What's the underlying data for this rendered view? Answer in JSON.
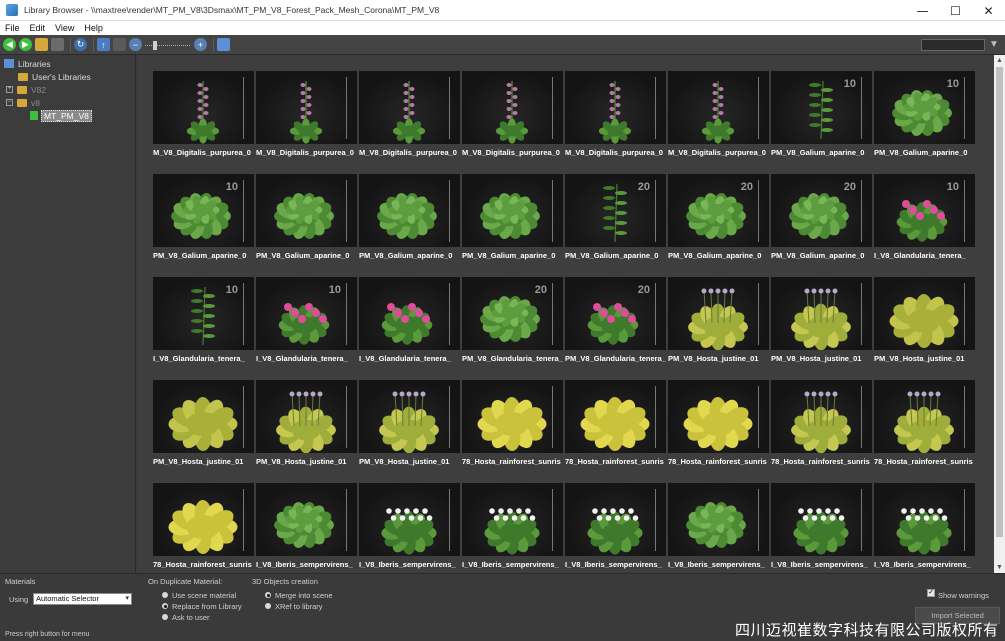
{
  "window": {
    "title": "Library Browser - \\\\maxtree\\render\\MT_PM_V8\\3Dsmax\\MT_PM_V8_Forest_Pack_Mesh_Corona\\MT_PM_V8",
    "minimize": "—",
    "maximize": "☐",
    "close": "✕"
  },
  "menu": {
    "items": [
      {
        "label": "File"
      },
      {
        "label": "Edit"
      },
      {
        "label": "View"
      },
      {
        "label": "Help"
      }
    ]
  },
  "toolbar": {
    "icons": [
      "back-icon",
      "forward-icon",
      "open-folder-icon",
      "save-icon",
      "refresh-icon",
      "sort-icon",
      "group-icon",
      "zoom-out-icon",
      "zoom-in-icon",
      "settings-icon"
    ],
    "colors": {
      "back": "#3fbf3f",
      "forward": "#3fbf3f",
      "folder": "#d4a93a"
    }
  },
  "tree": {
    "root_label": "Libraries",
    "items": [
      {
        "label": "User's Libraries"
      },
      {
        "label": "V82"
      },
      {
        "label": "v8"
      },
      {
        "label": "MT_PM_V8"
      }
    ]
  },
  "grid": {
    "tiles": [
      {
        "label": "M_V8_Digitalis_purpurea_0",
        "plant": "foxglove",
        "ruler": ""
      },
      {
        "label": "M_V8_Digitalis_purpurea_0",
        "plant": "foxglove",
        "ruler": ""
      },
      {
        "label": "M_V8_Digitalis_purpurea_0",
        "plant": "foxglove",
        "ruler": ""
      },
      {
        "label": "M_V8_Digitalis_purpurea_0",
        "plant": "foxglove",
        "ruler": ""
      },
      {
        "label": "M_V8_Digitalis_purpurea_0",
        "plant": "foxglove",
        "ruler": ""
      },
      {
        "label": "M_V8_Digitalis_purpurea_0",
        "plant": "foxglove",
        "ruler": ""
      },
      {
        "label": "PM_V8_Galium_aparine_0",
        "plant": "tall-green",
        "ruler": "10"
      },
      {
        "label": "PM_V8_Galium_aparine_0",
        "plant": "bush",
        "ruler": "10"
      },
      {
        "label": "PM_V8_Galium_aparine_0",
        "plant": "bush",
        "ruler": "10"
      },
      {
        "label": "PM_V8_Galium_aparine_0",
        "plant": "bush",
        "ruler": ""
      },
      {
        "label": "PM_V8_Galium_aparine_0",
        "plant": "bush",
        "ruler": ""
      },
      {
        "label": "PM_V8_Galium_aparine_0",
        "plant": "bush",
        "ruler": ""
      },
      {
        "label": "PM_V8_Galium_aparine_0",
        "plant": "tall-green",
        "ruler": "20"
      },
      {
        "label": "PM_V8_Galium_aparine_0",
        "plant": "bush",
        "ruler": "20"
      },
      {
        "label": "PM_V8_Galium_aparine_0",
        "plant": "bush",
        "ruler": "20"
      },
      {
        "label": "I_V8_Glandularia_tenera_",
        "plant": "pink-flower",
        "ruler": "10"
      },
      {
        "label": "I_V8_Glandularia_tenera_",
        "plant": "tall-green",
        "ruler": "10"
      },
      {
        "label": "I_V8_Glandularia_tenera_",
        "plant": "pink-flower",
        "ruler": "10"
      },
      {
        "label": "I_V8_Glandularia_tenera_",
        "plant": "pink-flower",
        "ruler": ""
      },
      {
        "label": "PM_V8_Glandularia_tenera_",
        "plant": "bush",
        "ruler": "20"
      },
      {
        "label": "PM_V8_Glandularia_tenera_",
        "plant": "pink-flower",
        "ruler": "20"
      },
      {
        "label": "PM_V8_Hosta_justine_01",
        "plant": "hosta-flower",
        "ruler": ""
      },
      {
        "label": "PM_V8_Hosta_justine_01",
        "plant": "hosta-flower",
        "ruler": ""
      },
      {
        "label": "PM_V8_Hosta_justine_01",
        "plant": "hosta",
        "ruler": ""
      },
      {
        "label": "PM_V8_Hosta_justine_01",
        "plant": "hosta",
        "ruler": ""
      },
      {
        "label": "PM_V8_Hosta_justine_01",
        "plant": "hosta-flower",
        "ruler": ""
      },
      {
        "label": "PM_V8_Hosta_justine_01",
        "plant": "hosta-flower",
        "ruler": ""
      },
      {
        "label": "78_Hosta_rainforest_sunris",
        "plant": "hosta-yellow",
        "ruler": ""
      },
      {
        "label": "78_Hosta_rainforest_sunris",
        "plant": "hosta-yellow",
        "ruler": ""
      },
      {
        "label": "78_Hosta_rainforest_sunris",
        "plant": "hosta-yellow",
        "ruler": ""
      },
      {
        "label": "78_Hosta_rainforest_sunris",
        "plant": "hosta-flower",
        "ruler": ""
      },
      {
        "label": "78_Hosta_rainforest_sunris",
        "plant": "hosta-flower",
        "ruler": ""
      },
      {
        "label": "78_Hosta_rainforest_sunris",
        "plant": "hosta-yellow",
        "ruler": ""
      },
      {
        "label": "I_V8_Iberis_sempervirens_",
        "plant": "bush",
        "ruler": ""
      },
      {
        "label": "I_V8_Iberis_sempervirens_",
        "plant": "white-flower",
        "ruler": ""
      },
      {
        "label": "I_V8_Iberis_sempervirens_",
        "plant": "white-flower",
        "ruler": ""
      },
      {
        "label": "I_V8_Iberis_sempervirens_",
        "plant": "white-flower",
        "ruler": ""
      },
      {
        "label": "I_V8_Iberis_sempervirens_",
        "plant": "bush",
        "ruler": ""
      },
      {
        "label": "I_V8_Iberis_sempervirens_",
        "plant": "white-flower",
        "ruler": ""
      },
      {
        "label": "I_V8_Iberis_sempervirens_",
        "plant": "white-flower",
        "ruler": ""
      }
    ]
  },
  "bottom": {
    "materials_label": "Materials",
    "using_label": "Using",
    "using_value": "Automatic Selector",
    "duplicate_label": "On Duplicate Material:",
    "duplicate_options": [
      "Use scene material",
      "Replace from Library",
      "Ask to user"
    ],
    "duplicate_selected": 1,
    "objects_label": "3D Objects creation",
    "objects_options": [
      "Merge into scene",
      "XRef to library"
    ],
    "objects_selected": 0,
    "show_warnings": "Show warnings",
    "show_warnings_checked": true,
    "import_button": "Import Selected"
  },
  "status": {
    "text": "Press right button for menu"
  },
  "watermark": "四川迈视崔数字科技有限公司版权所有"
}
